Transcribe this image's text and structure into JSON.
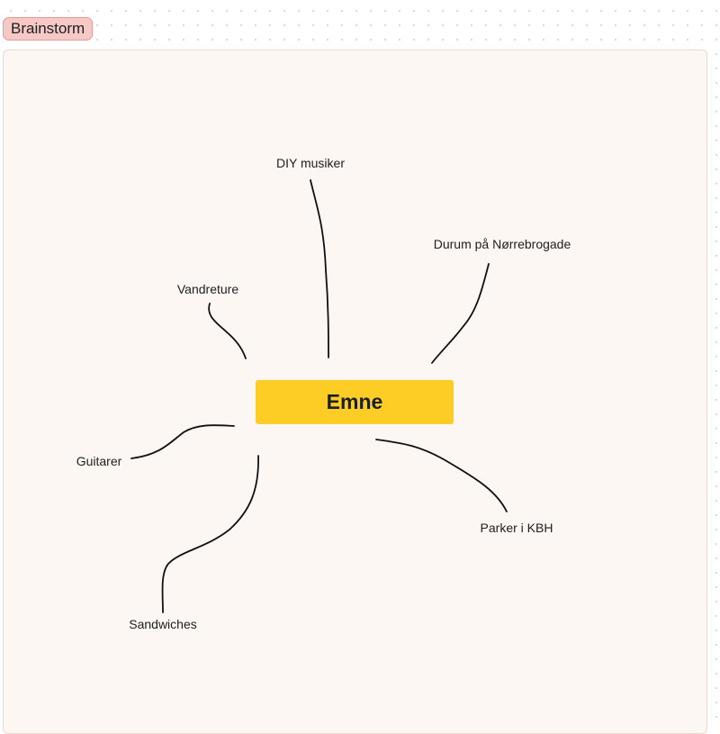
{
  "section": {
    "title": "Brainstorm"
  },
  "mindmap": {
    "central_topic": "Emne",
    "branches": [
      {
        "id": "diy",
        "label": "DIY musiker"
      },
      {
        "id": "durum",
        "label": "Durum på Nørrebrogade"
      },
      {
        "id": "vandreture",
        "label": "Vandreture"
      },
      {
        "id": "guitarer",
        "label": "Guitarer"
      },
      {
        "id": "parker",
        "label": "Parker i KBH"
      },
      {
        "id": "sandwiches",
        "label": "Sandwiches"
      }
    ]
  },
  "colors": {
    "topic_fill": "#fdcd26",
    "section_tag_fill": "#f6c9c6",
    "section_background": "#fcf7f3",
    "connector_stroke": "#111111"
  }
}
